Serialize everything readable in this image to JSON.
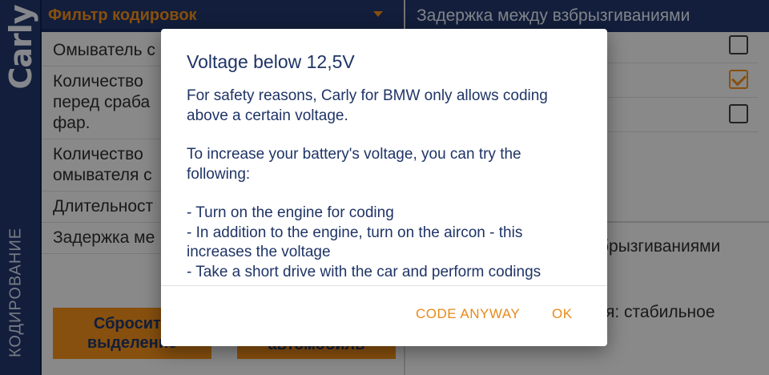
{
  "sidebar": {
    "logo_text": "Carly",
    "section_label": "КОДИРОВАНИЕ"
  },
  "filter": {
    "label": "Фильтр кодировок"
  },
  "left_list": {
    "items": [
      {
        "lines": [
          "Омыватель с"
        ]
      },
      {
        "lines": [
          "Количество",
          "перед сраба",
          "фар."
        ]
      },
      {
        "lines": [
          "Количество",
          "омывателя с"
        ]
      },
      {
        "lines": [
          "Длительност"
        ]
      },
      {
        "lines": [
          "Задержка ме"
        ]
      }
    ]
  },
  "left_buttons": {
    "reset_label": "Сбросить выделение",
    "vehicle_label": "автомобиль"
  },
  "right_panel": {
    "header": "Задержка между взбрызгиваниями",
    "options": [
      {
        "checked": false
      },
      {
        "checked": true
      },
      {
        "checked": false
      }
    ],
    "summary_fragment": "брызгиваниями",
    "value_fragment": "я: стабильное"
  },
  "dialog": {
    "title": "Voltage below 12,5V",
    "paragraph_1": "For safety reasons, Carly for BMW only allows coding above a certain voltage.",
    "paragraph_2": "To increase your battery's voltage, you can try the following:",
    "tips": [
      "- Turn on the engine for coding",
      "- In addition to the engine, turn on the aircon - this increases the voltage",
      "- Take a short drive with the car and perform codings"
    ],
    "code_anyway_label": "CODE ANYWAY",
    "ok_label": "OK"
  },
  "colors": {
    "brand_navy": "#1f3466",
    "accent_orange": "#e88a19"
  }
}
